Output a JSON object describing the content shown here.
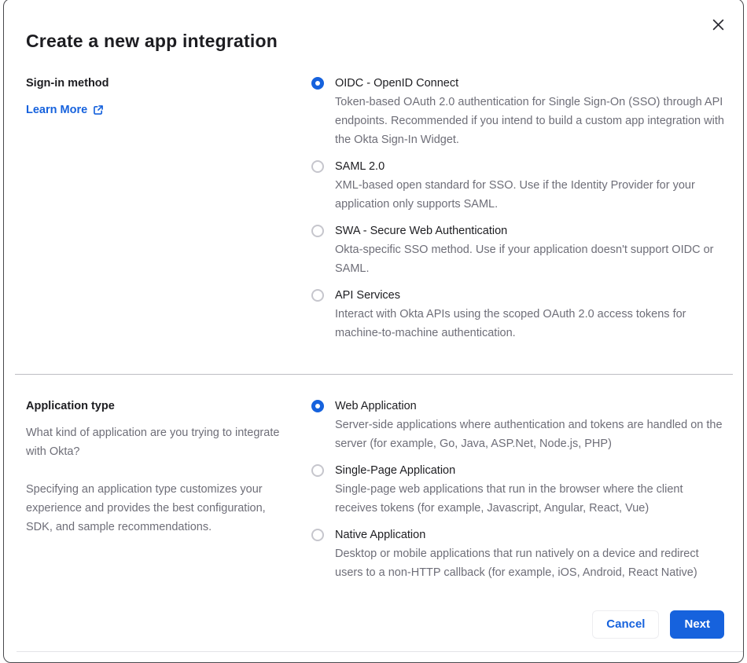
{
  "modal": {
    "title": "Create a new app integration"
  },
  "signin_section": {
    "heading": "Sign-in method",
    "learn_more_label": "Learn More",
    "options": [
      {
        "label": "OIDC - OpenID Connect",
        "description": "Token-based OAuth 2.0 authentication for Single Sign-On (SSO) through API endpoints. Recommended if you intend to build a custom app integration with the Okta Sign-In Widget.",
        "selected": true
      },
      {
        "label": "SAML 2.0",
        "description": "XML-based open standard for SSO. Use if the Identity Provider for your application only supports SAML.",
        "selected": false
      },
      {
        "label": "SWA - Secure Web Authentication",
        "description": "Okta-specific SSO method. Use if your application doesn't support OIDC or SAML.",
        "selected": false
      },
      {
        "label": "API Services",
        "description": "Interact with Okta APIs using the scoped OAuth 2.0 access tokens for machine-to-machine authentication.",
        "selected": false
      }
    ]
  },
  "apptype_section": {
    "heading": "Application type",
    "description_1": "What kind of application are you trying to integrate with Okta?",
    "description_2": "Specifying an application type customizes your experience and provides the best configuration, SDK, and sample recommendations.",
    "options": [
      {
        "label": "Web Application",
        "description": "Server-side applications where authentication and tokens are handled on the server (for example, Go, Java, ASP.Net, Node.js, PHP)",
        "selected": true
      },
      {
        "label": "Single-Page Application",
        "description": "Single-page web applications that run in the browser where the client receives tokens (for example, Javascript, Angular, React, Vue)",
        "selected": false
      },
      {
        "label": "Native Application",
        "description": "Desktop or mobile applications that run natively on a device and redirect users to a non-HTTP callback (for example, iOS, Android, React Native)",
        "selected": false
      }
    ]
  },
  "footer": {
    "cancel_label": "Cancel",
    "next_label": "Next"
  },
  "colors": {
    "primary_blue": "#1662dd",
    "heading_text": "#1d1d21",
    "body_text": "#6e6e78"
  }
}
